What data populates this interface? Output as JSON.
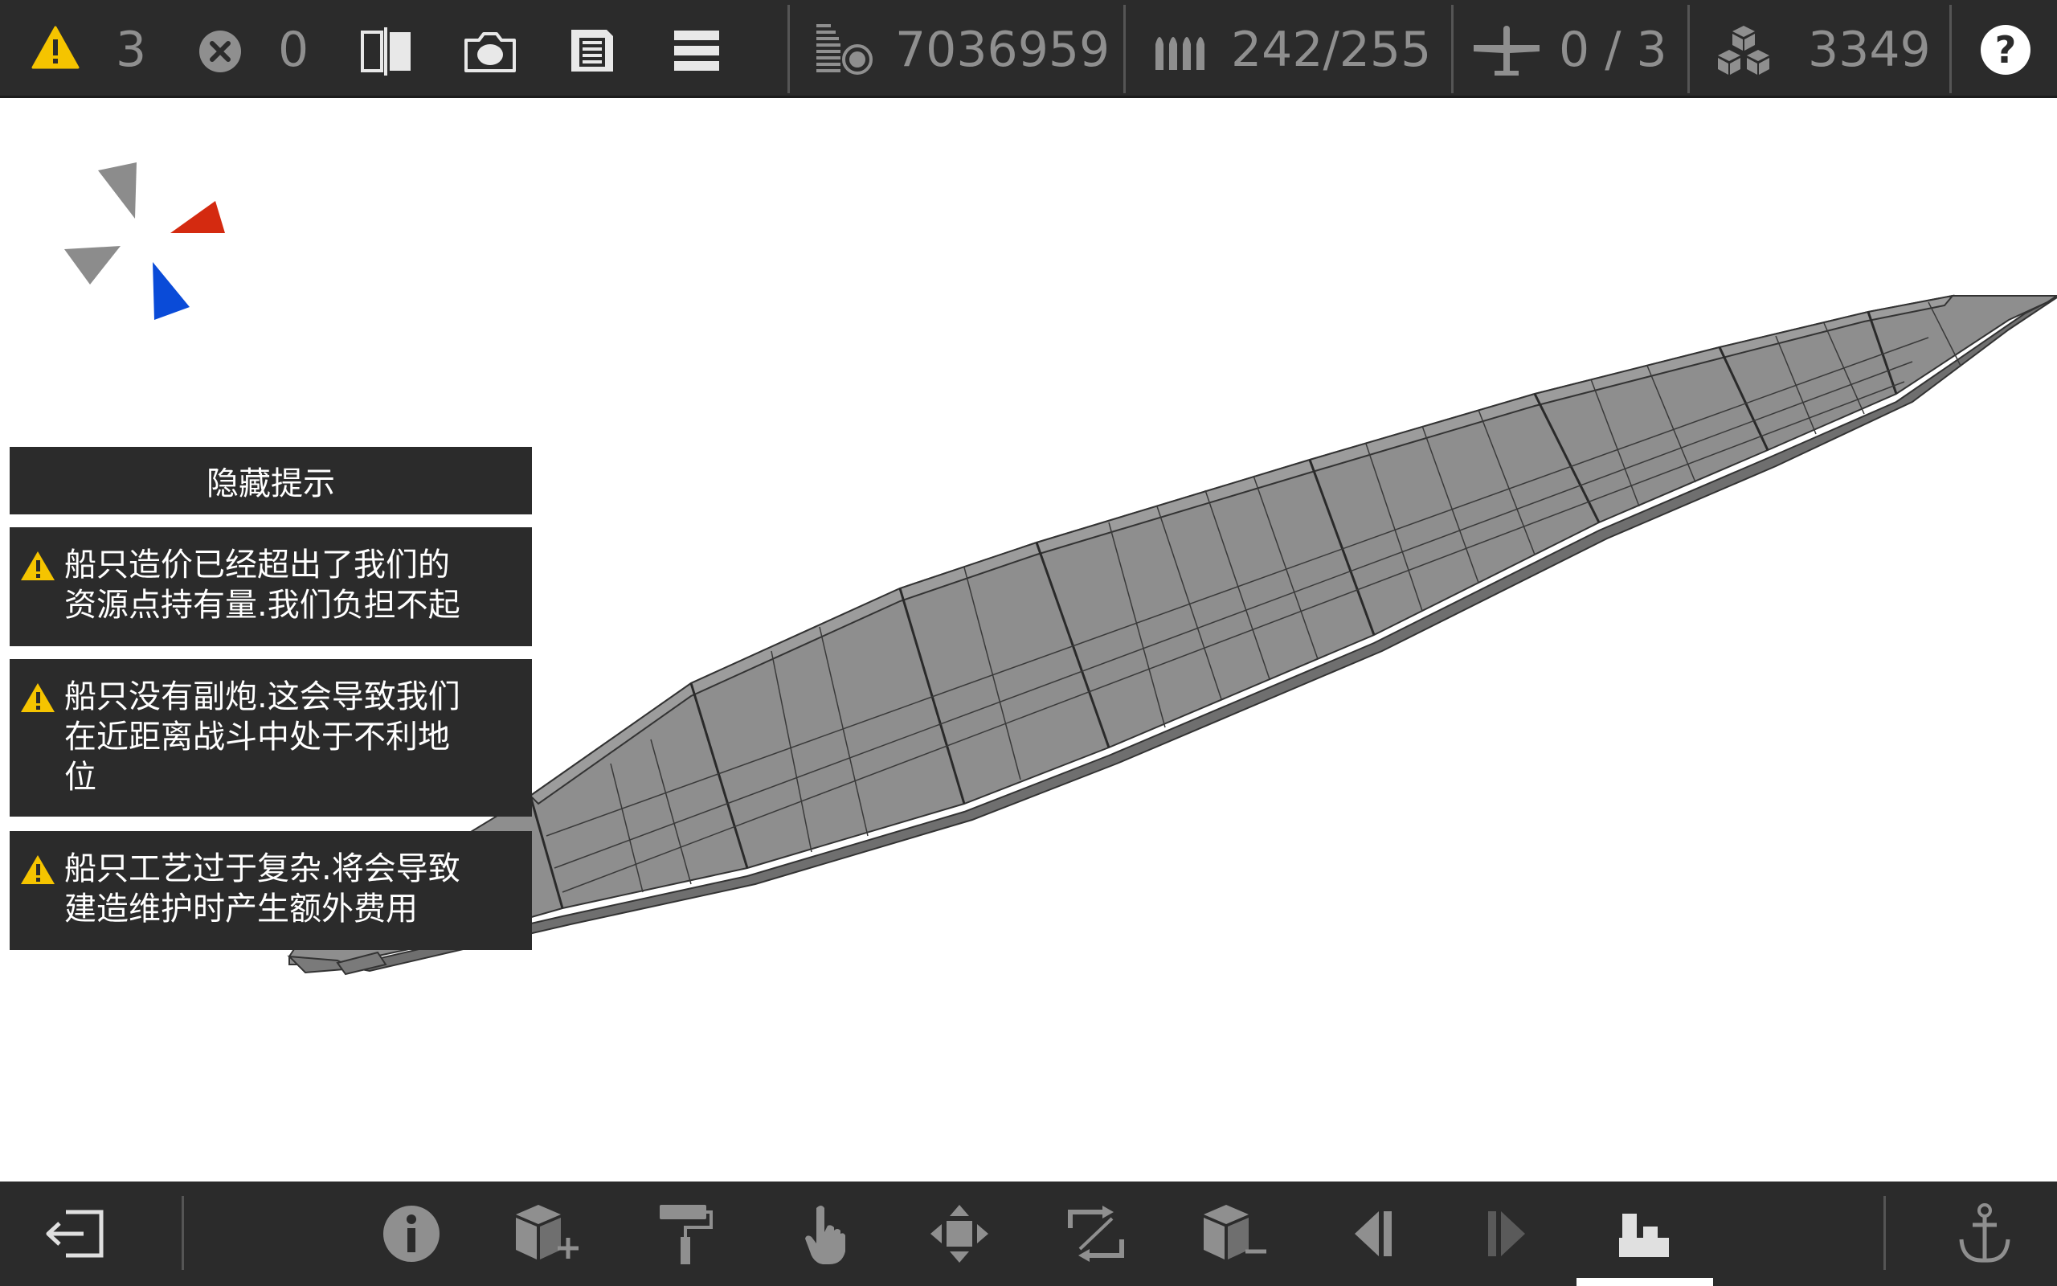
{
  "topbar": {
    "warnings_count": "3",
    "errors_count": "0",
    "money": "7036959",
    "ammo": "242/255",
    "aircraft": "0 / 3",
    "resources": "3349",
    "help_label": "?"
  },
  "hints": {
    "hide_button": "隐藏提示",
    "items": [
      {
        "line1": "船只造价已经超出了我们的",
        "line2": "资源点持有量.我们负担不起",
        "line3": ""
      },
      {
        "line1": "船只没有副炮.这会导致我们",
        "line2": "在近距离战斗中处于不利地",
        "line3": "位"
      },
      {
        "line1": "船只工艺过于复杂.将会导致",
        "line2": "建造维护时产生额外费用",
        "line3": ""
      }
    ]
  },
  "colors": {
    "bar_bg": "#2b2b2b",
    "icon_gray": "#8f8f8f",
    "warning_yellow": "#f5c400",
    "axis_red": "#d42a10",
    "axis_blue": "#0a4bd8",
    "hull_gray": "#8e8e8e"
  },
  "icons": {
    "warning": "warning-icon",
    "error": "error-icon",
    "compare": "compare-icon",
    "camera": "camera-icon",
    "save": "save-icon",
    "menu": "menu-icon",
    "money": "money-icon",
    "ammo": "ammo-icon",
    "aircraft": "aircraft-icon",
    "resources": "resources-icon",
    "help": "help-icon",
    "exit": "exit-icon",
    "info": "info-icon",
    "add_part": "add-part-icon",
    "paint": "paint-roller-icon",
    "select": "select-hand-icon",
    "move": "move-icon",
    "rotate": "rotate-icon",
    "remove_part": "remove-part-icon",
    "previous": "previous-icon",
    "next": "next-icon",
    "ship_parts": "ship-parts-icon",
    "anchor": "anchor-icon"
  }
}
